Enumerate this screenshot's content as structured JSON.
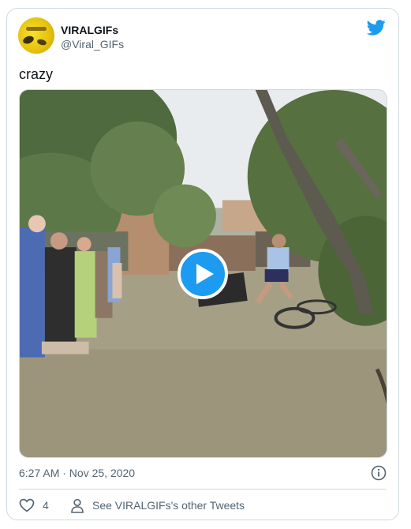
{
  "author": {
    "display_name": "VIRALGIFs",
    "handle": "@Viral_GIFs",
    "avatar": "yellow-avatar-image"
  },
  "tweet": {
    "text": "crazy",
    "media": {
      "type": "video",
      "icon": "play-icon"
    }
  },
  "meta": {
    "timestamp": "6:27 AM · Nov 25, 2020",
    "info_icon": "info-icon"
  },
  "actions": {
    "likes_count": "4",
    "like_icon": "heart-icon",
    "other_tweets_label": "See VIRALGIFs's other Tweets",
    "other_tweets_icon": "person-icon"
  },
  "colors": {
    "brand": "#1d9bf0",
    "text": "#0f1419",
    "secondary": "#536471",
    "border": "#cfd9de"
  }
}
